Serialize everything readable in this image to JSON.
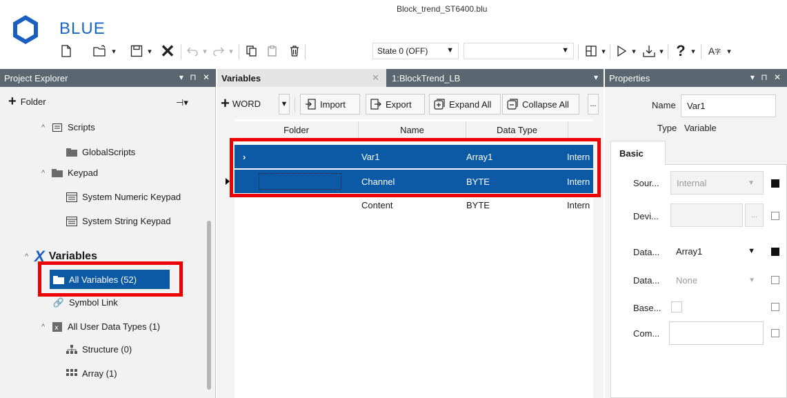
{
  "app": {
    "name": "BLUE",
    "filename": "Block_trend_ST6400.blu"
  },
  "toolbar": {
    "state_label": "State 0 (OFF)",
    "blank_combo": "",
    "icons": [
      "new-file-icon",
      "open-icon",
      "dropdown",
      "save-icon",
      "dropdown",
      "close-x-icon",
      "undo-icon",
      "dropdown",
      "redo-icon",
      "dropdown",
      "copy-icon",
      "paste-icon",
      "delete-icon",
      "layout-icon",
      "run-icon",
      "download-icon",
      "help-icon",
      "font-icon"
    ]
  },
  "project_explorer": {
    "title": "Project Explorer",
    "controls": "▾ ⊓ ✕",
    "folder_button": "Folder",
    "tree": {
      "scripts": "Scripts",
      "global_scripts": "GlobalScripts",
      "keypad": "Keypad",
      "sys_numeric": "System Numeric Keypad",
      "sys_string": "System String Keypad",
      "variables": "Variables",
      "all_variables": "All Variables (52)",
      "symbol_link": "Symbol Link",
      "all_udt": "All User Data Types (1)",
      "structure": "Structure (0)",
      "array": "Array (1)"
    }
  },
  "editor": {
    "tabs": [
      {
        "label": "Variables",
        "active": true
      },
      {
        "label": "1:BlockTrend_LB",
        "active": false
      }
    ],
    "toolbar": {
      "word_label": "WORD",
      "import": "Import",
      "export": "Export",
      "expand_all": "Expand All",
      "collapse_all": "Collapse All",
      "more": "..."
    },
    "columns": [
      "Folder",
      "Name",
      "Data Type"
    ],
    "rows": [
      {
        "expander": "›",
        "folder": "",
        "name": "Var1",
        "type": "Array1",
        "source": "Intern",
        "selected": true
      },
      {
        "expander": "",
        "folder": "",
        "name": "Channel",
        "type": "BYTE",
        "source": "Intern",
        "selected": true
      },
      {
        "expander": "",
        "folder": "",
        "name": "Content",
        "type": "BYTE",
        "source": "Intern",
        "selected": false
      }
    ]
  },
  "properties": {
    "title": "Properties",
    "controls": "▾ ⊓ ✕",
    "name_label": "Name",
    "name_value": "Var1",
    "type_label": "Type",
    "type_value": "Variable",
    "tab_basic": "Basic",
    "fields": [
      {
        "label": "Sour...",
        "value": "Internal",
        "disabled": true,
        "dropdown": true,
        "checked": true
      },
      {
        "label": "Devi...",
        "value": "",
        "disabled": true,
        "ellipsis": "...",
        "checked": false
      },
      {
        "label": "Data...",
        "value": "Array1",
        "disabled": false,
        "dropdown": true,
        "checked": true
      },
      {
        "label": "Data...",
        "value": "None",
        "disabled": true,
        "dropdown": true,
        "checked": false
      },
      {
        "label": "Base...",
        "value": "",
        "checkbox": true,
        "checked": false
      },
      {
        "label": "Com...",
        "value": "",
        "disabled": false,
        "checked": false
      }
    ]
  },
  "colors": {
    "accent": "#0c5aa6",
    "header": "#5a6670",
    "highlight_box": "#ee0000",
    "logo": "#1a66c6"
  }
}
